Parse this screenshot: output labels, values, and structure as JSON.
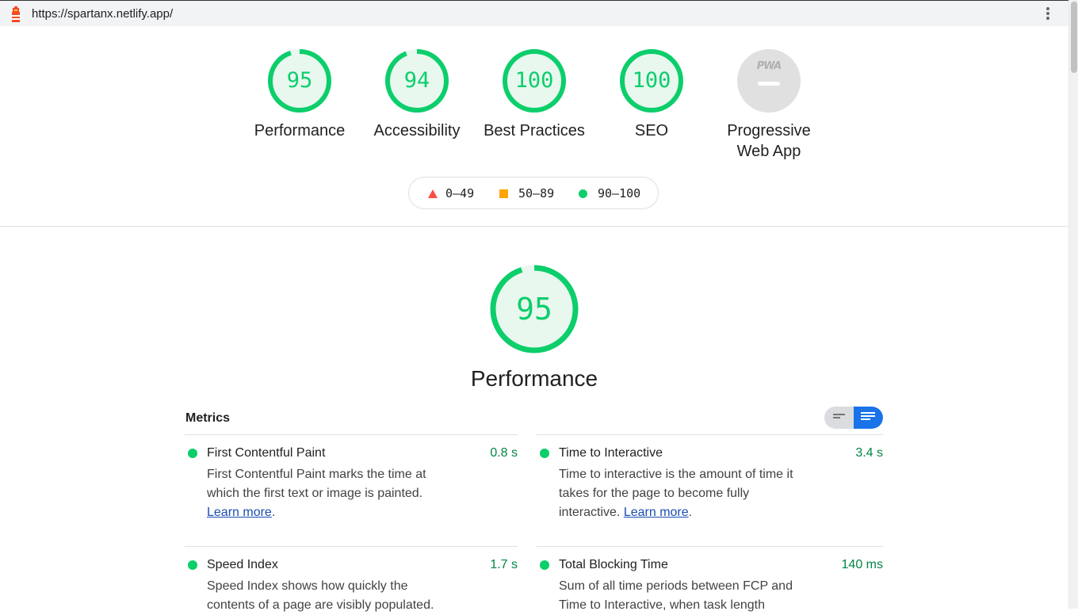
{
  "browser": {
    "url": "https://spartanx.netlify.app/"
  },
  "summary": {
    "gauges": [
      {
        "score": "95",
        "label": "Performance"
      },
      {
        "score": "94",
        "label": "Accessibility"
      },
      {
        "score": "100",
        "label": "Best Practices"
      },
      {
        "score": "100",
        "label": "SEO"
      }
    ],
    "pwa": {
      "badge": "PWA",
      "label_line1": "Progressive",
      "label_line2": "Web App"
    }
  },
  "legend": {
    "fail": "0–49",
    "average": "50–89",
    "pass": "90–100"
  },
  "performance": {
    "score": "95",
    "title": "Performance"
  },
  "metrics": {
    "title": "Metrics",
    "items": [
      {
        "name": "First Contentful Paint",
        "value": "0.8 s",
        "desc": "First Contentful Paint marks the time at which the first text or image is painted.",
        "link": "Learn more",
        "suffix": "."
      },
      {
        "name": "Time to Interactive",
        "value": "3.4 s",
        "desc": "Time to interactive is the amount of time it takes for the page to become fully interactive.",
        "link": "Learn more",
        "suffix": "."
      },
      {
        "name": "Speed Index",
        "value": "1.7 s",
        "desc": "Speed Index shows how quickly the contents of a page are visibly populated.",
        "link": "",
        "suffix": ""
      },
      {
        "name": "Total Blocking Time",
        "value": "140 ms",
        "desc": "Sum of all time periods between FCP and Time to Interactive, when task length",
        "link": "",
        "suffix": ""
      }
    ]
  },
  "colors": {
    "pass": "#0cce6b",
    "average": "#ffa400",
    "fail": "#ff4e42",
    "toggle_active": "#1a73e8"
  }
}
